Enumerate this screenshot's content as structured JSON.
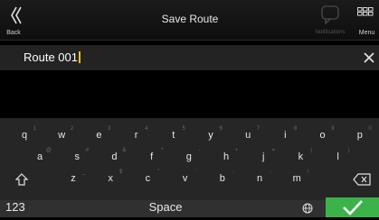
{
  "header": {
    "back_label": "Back",
    "title": "Save Route",
    "notifications_label": "Notifications",
    "menu_label": "Menu"
  },
  "input": {
    "value": "Route 001"
  },
  "keyboard": {
    "rows": [
      [
        {
          "k": "q",
          "h": "1"
        },
        {
          "k": "w",
          "h": "2"
        },
        {
          "k": "e",
          "h": "3"
        },
        {
          "k": "r",
          "h": "4"
        },
        {
          "k": "t",
          "h": "5"
        },
        {
          "k": "y",
          "h": "6"
        },
        {
          "k": "u",
          "h": "7"
        },
        {
          "k": "i",
          "h": "8"
        },
        {
          "k": "o",
          "h": "9"
        },
        {
          "k": "p",
          "h": "0"
        }
      ],
      [
        {
          "k": "a",
          "h": "@"
        },
        {
          "k": "s",
          "h": "#"
        },
        {
          "k": "d",
          "h": "&"
        },
        {
          "k": "f",
          "h": "*"
        },
        {
          "k": "g",
          "h": "-"
        },
        {
          "k": "h",
          "h": "+"
        },
        {
          "k": "j",
          "h": "="
        },
        {
          "k": "k",
          "h": "("
        },
        {
          "k": "l",
          "h": ")"
        }
      ],
      [
        {
          "k": "z",
          "h": "_"
        },
        {
          "k": "x",
          "h": "$"
        },
        {
          "k": "c",
          "h": "\""
        },
        {
          "k": "v",
          "h": "'"
        },
        {
          "k": "b",
          "h": ":"
        },
        {
          "k": "n",
          "h": ";"
        },
        {
          "k": "m",
          "h": "/"
        }
      ]
    ],
    "shift_icon": "shift-icon",
    "backspace_icon": "backspace-icon",
    "numbers_label": "123",
    "space_label": "Space",
    "globe_icon": "globe-icon",
    "enter_icon": "checkmark-icon",
    "enter_color": "#3bb34a"
  },
  "colors": {
    "caret": "#f4c21b",
    "background": "#000000",
    "key_area": "#262626"
  }
}
